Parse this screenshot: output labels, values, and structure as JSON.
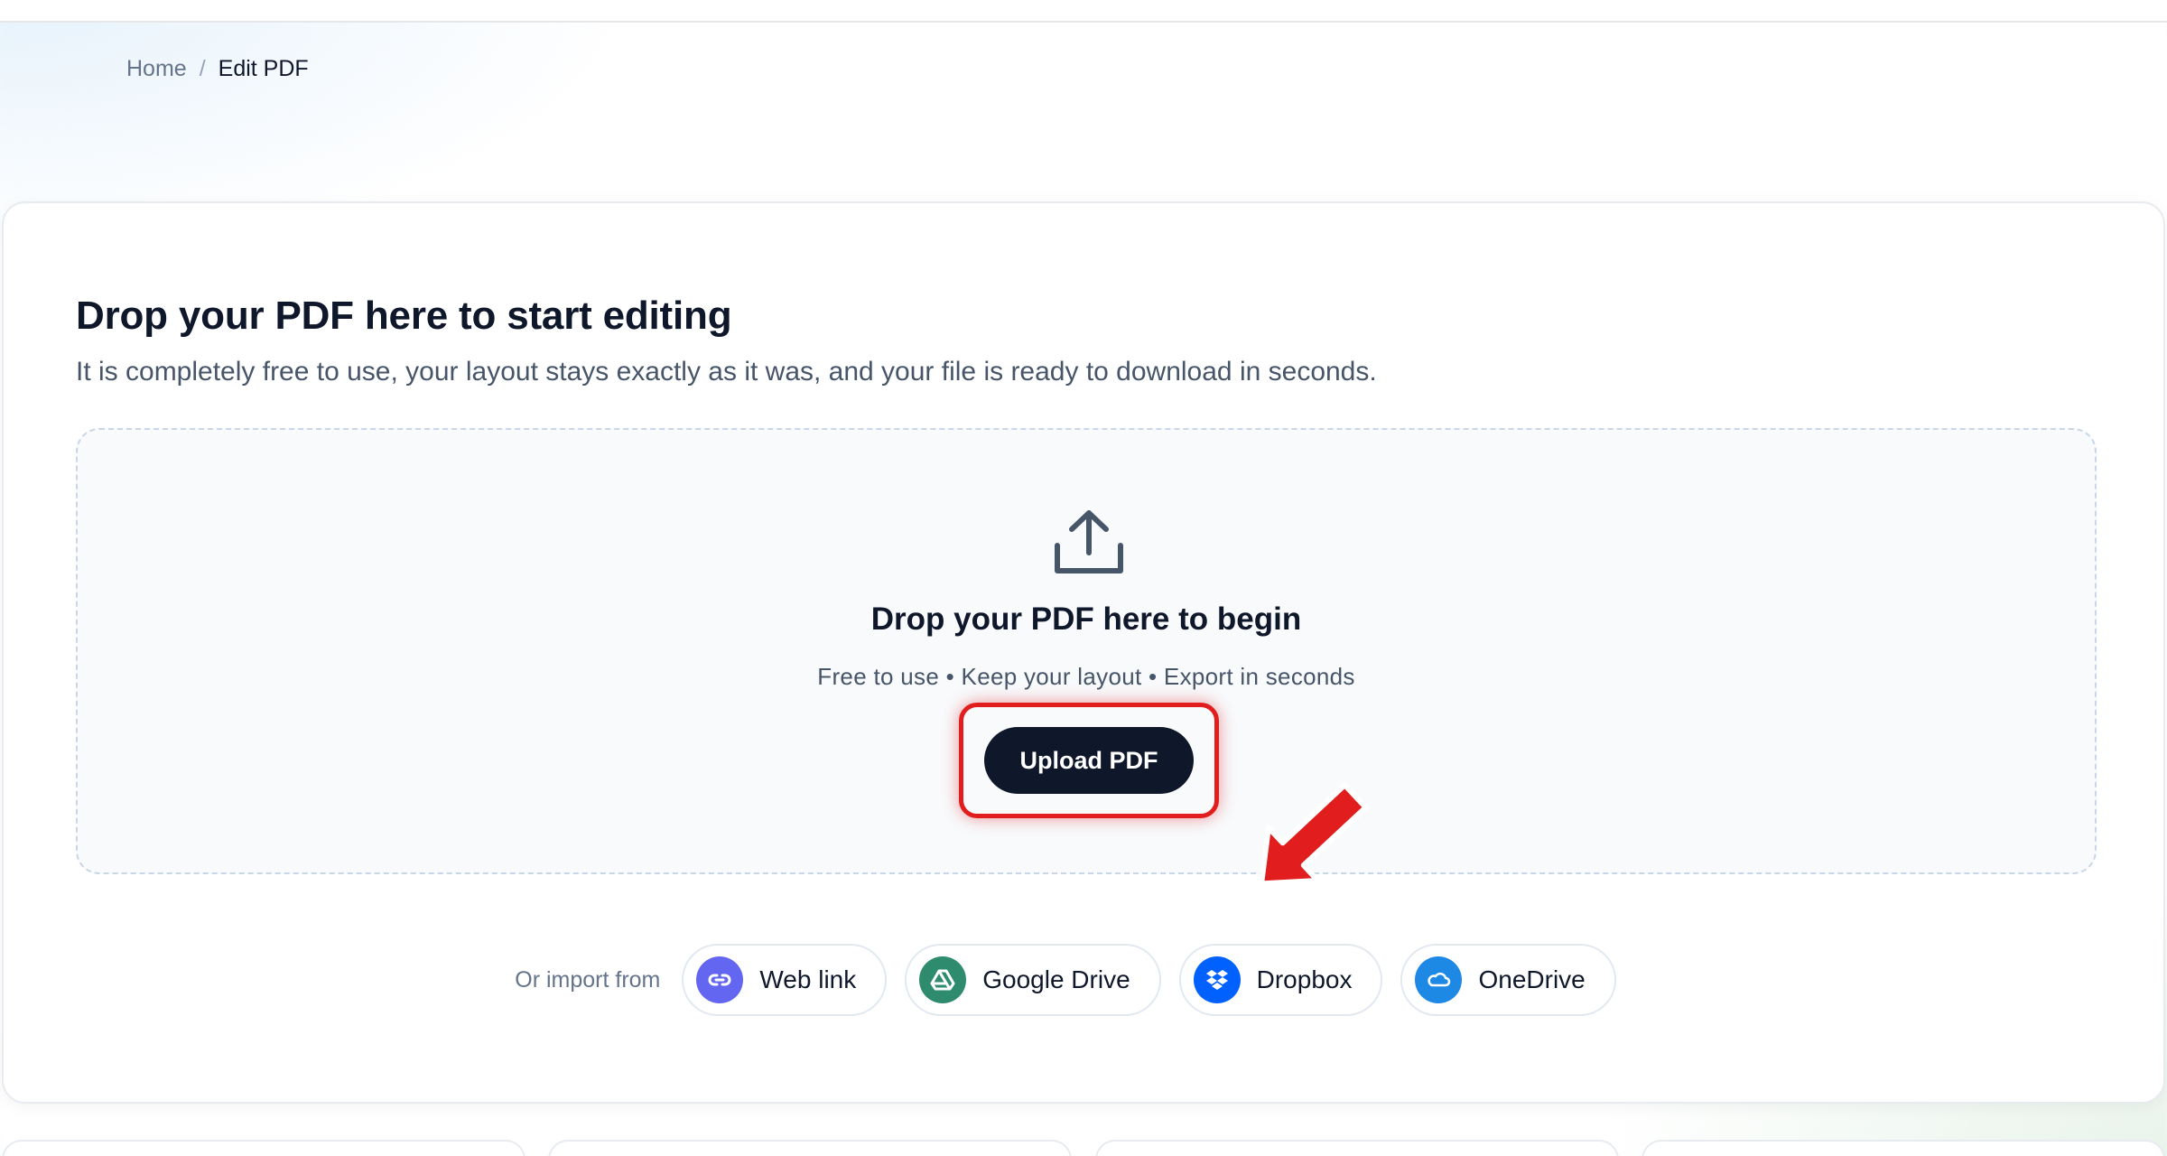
{
  "breadcrumb": {
    "home": "Home",
    "separator": "/",
    "current": "Edit PDF"
  },
  "card": {
    "title": "Drop your PDF here to start editing",
    "subtitle": "It is completely free to use, your layout stays exactly as it was, and your file is ready to download in seconds."
  },
  "dropzone": {
    "icon": "upload-icon",
    "title": "Drop your PDF here to begin",
    "subtitle": "Free to use • Keep your layout • Export in seconds",
    "upload_label": "Upload PDF"
  },
  "import": {
    "label": "Or import from",
    "sources": [
      {
        "label": "Web link",
        "icon": "link-icon",
        "color": "#6366f1"
      },
      {
        "label": "Google Drive",
        "icon": "google-drive-icon",
        "color": "#2e8b6e"
      },
      {
        "label": "Dropbox",
        "icon": "dropbox-icon",
        "color": "#0061fe"
      },
      {
        "label": "OneDrive",
        "icon": "onedrive-icon",
        "color": "#1e88e5"
      }
    ]
  },
  "colors": {
    "primary": "#0f172a",
    "highlight": "#e11d1d"
  }
}
